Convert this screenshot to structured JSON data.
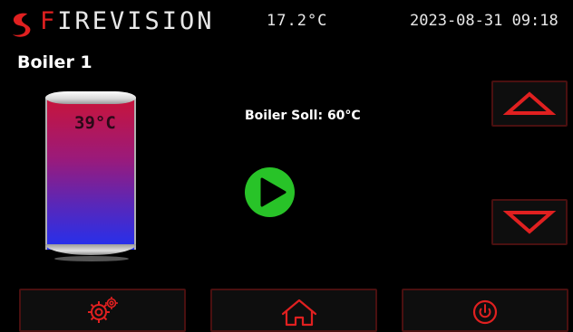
{
  "header": {
    "brand_first": "F",
    "brand_rest": "IREVISION",
    "outdoor_temperature": "17.2°C",
    "datetime": "2023-08-31 09:18"
  },
  "page": {
    "title": "Boiler 1"
  },
  "boiler": {
    "current_temperature": "39°C",
    "setpoint_label": "Boiler Soll:",
    "setpoint_value": "60°C"
  },
  "controls": {
    "play_icon": "play-icon",
    "up_icon": "triangle-up-icon",
    "down_icon": "triangle-down-icon"
  },
  "nav": {
    "settings_icon": "gear-icon",
    "home_icon": "home-icon",
    "power_icon": "power-icon"
  },
  "colors": {
    "accent_red": "#e02020",
    "play_green": "#28c328",
    "tank_top": "#c8143a",
    "tank_bottom": "#2230f0"
  }
}
